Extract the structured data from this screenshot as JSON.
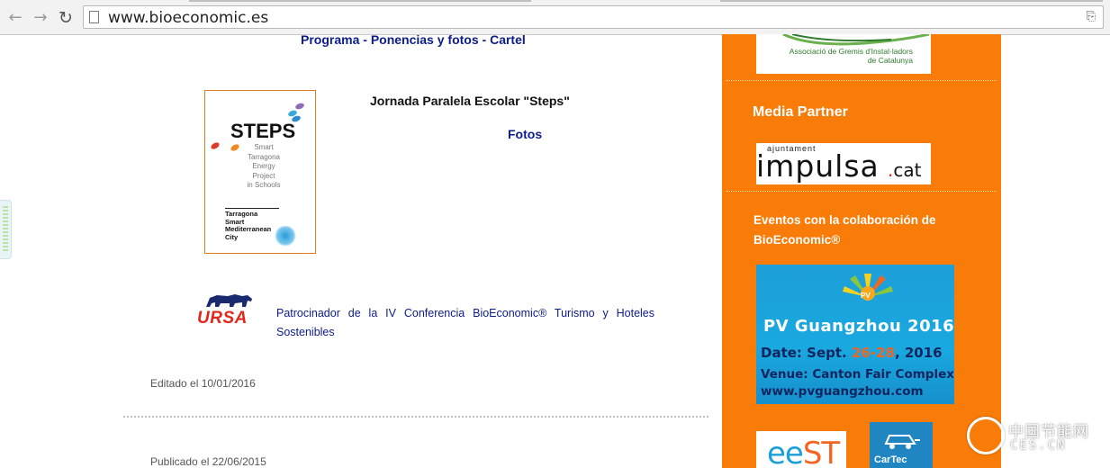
{
  "browser": {
    "url": "www.bioeconomic.es",
    "icons": {
      "back": "back-arrow-icon",
      "forward": "forward-arrow-icon",
      "reload": "reload-icon",
      "page": "page-icon",
      "translate": "translate-icon"
    }
  },
  "main": {
    "links": [
      {
        "label": "Programa"
      },
      {
        "label": "Ponencias y fotos"
      },
      {
        "label": "Cartel"
      }
    ],
    "link_separator": " - ",
    "steps_image": {
      "title": "STEPS",
      "subtitle_lines": [
        "Smart",
        "Tarragona",
        "Energy",
        "Project",
        "in Schools"
      ],
      "city_lines": [
        "Tarragona",
        "Smart",
        "Mediterranean",
        "City"
      ]
    },
    "jornada_title": "Jornada Paralela Escolar \"Steps\"",
    "fotos_link": "Fotos",
    "ursa_logo_text": "URSA",
    "sponsor_text": "Patrocinador de la IV Conferencia BioEconomic® Turismo y Hoteles Sostenibles",
    "editado": "Editado el 10/01/2016",
    "publicado": "Publicado el 22/06/2015"
  },
  "sidebar": {
    "background_color": "#f97b08",
    "agremia_lines": [
      "Associació de Gremis d'Instal·ladors",
      "de Catalunya"
    ],
    "media_partner_title": "Media Partner",
    "impulsa": {
      "small": "ajuntament",
      "big": "impulsa",
      "dot": ".",
      "tld": "cat"
    },
    "eventos_title": "Eventos con la colaboración de BioEconomic®",
    "pv_banner": {
      "logo": "PV",
      "title": "PV Guangzhou 2016",
      "date_prefix": "Date: Sept. ",
      "date_highlight": "26-28",
      "date_suffix": ", 2016",
      "venue": "Venue: Canton Fair Complex",
      "site": "www.pvguangzhou.com"
    },
    "eest_logo": {
      "part1": "ee",
      "part2": "ST"
    },
    "cartec_logo": "CarTec"
  },
  "watermark": {
    "cn": "中国节能网",
    "en": "CES.CN"
  }
}
